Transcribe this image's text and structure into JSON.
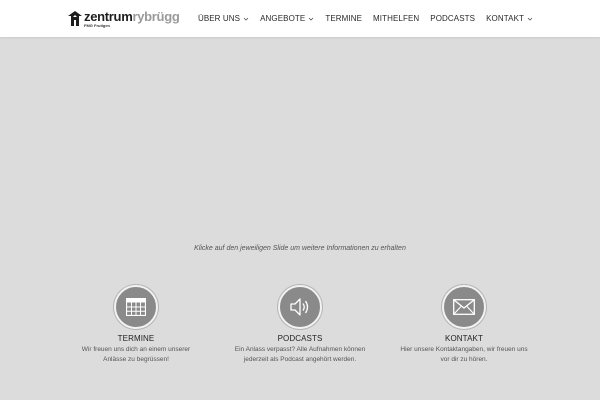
{
  "header": {
    "logo": {
      "word1": "zentrum",
      "word2": "rybrügg",
      "subtitle": "FMG Frutigen"
    },
    "nav": [
      {
        "label": "ÜBER UNS",
        "has_dropdown": true
      },
      {
        "label": "ANGEBOTE",
        "has_dropdown": true
      },
      {
        "label": "TERMINE",
        "has_dropdown": false
      },
      {
        "label": "MITHELFEN",
        "has_dropdown": false
      },
      {
        "label": "PODCASTS",
        "has_dropdown": false
      },
      {
        "label": "KONTAKT",
        "has_dropdown": true
      }
    ]
  },
  "main": {
    "hint": "Klicke auf den jeweiligen Slide um weitere Informationen zu erhalten",
    "features": [
      {
        "icon": "calendar-grid-icon",
        "title": "TERMINE",
        "text": "Wir freuen uns dich an einem unserer Anlässe zu begrüssen!"
      },
      {
        "icon": "speaker-icon",
        "title": "PODCASTS",
        "text": "Ein Anlass verpasst? Alle Aufnahmen können jederzeit als Podcast angehört werden."
      },
      {
        "icon": "envelope-icon",
        "title": "KONTAKT",
        "text": "Hier unsere Kontaktangaben, wir freuen uns vor dir zu hören."
      }
    ]
  },
  "colors": {
    "page_background": "#dcdcdc",
    "header_background": "#ffffff",
    "icon_circle": "#8a8a8a",
    "logo_dark": "#1e1e1e",
    "logo_light": "#9a9a9a"
  }
}
